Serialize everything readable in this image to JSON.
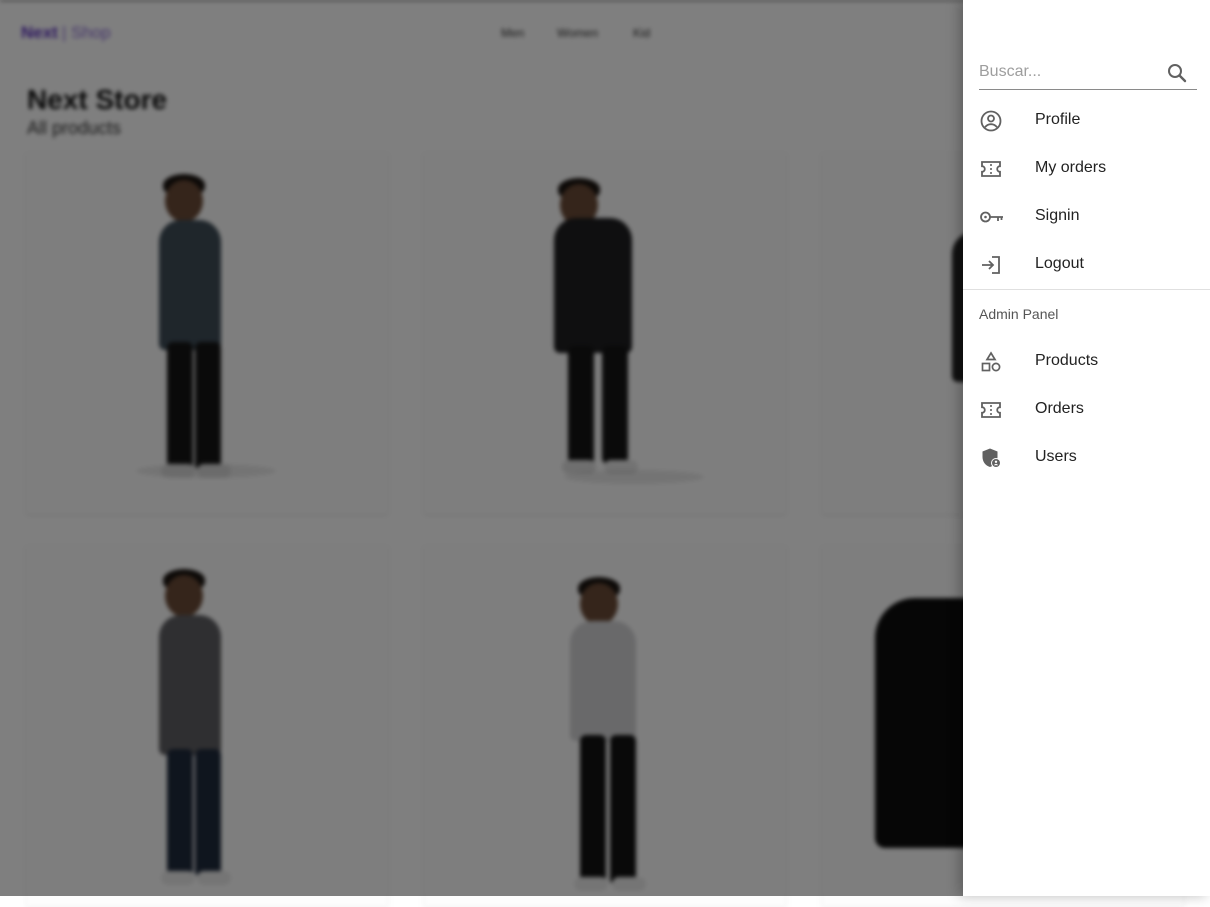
{
  "background": {
    "logo_bold": "Next",
    "logo_light": "| Shop",
    "nav": [
      "Men",
      "Women",
      "Kid"
    ],
    "title": "Next Store",
    "subtitle": "All products"
  },
  "drawer": {
    "search": {
      "placeholder": "Buscar...",
      "value": ""
    },
    "items": [
      {
        "label": "Profile",
        "icon": "account-circle-icon"
      },
      {
        "label": "My orders",
        "icon": "ticket-icon"
      },
      {
        "label": "Signin",
        "icon": "key-icon"
      },
      {
        "label": "Logout",
        "icon": "login-icon"
      }
    ],
    "admin_header": "Admin Panel",
    "admin_items": [
      {
        "label": "Products",
        "icon": "category-icon"
      },
      {
        "label": "Orders",
        "icon": "ticket-icon"
      },
      {
        "label": "Users",
        "icon": "admin-user-icon"
      }
    ]
  },
  "colors": {
    "brand": "#5b2fbf",
    "overlay": "rgba(0,0,0,0.5)",
    "icon": "#616161"
  }
}
